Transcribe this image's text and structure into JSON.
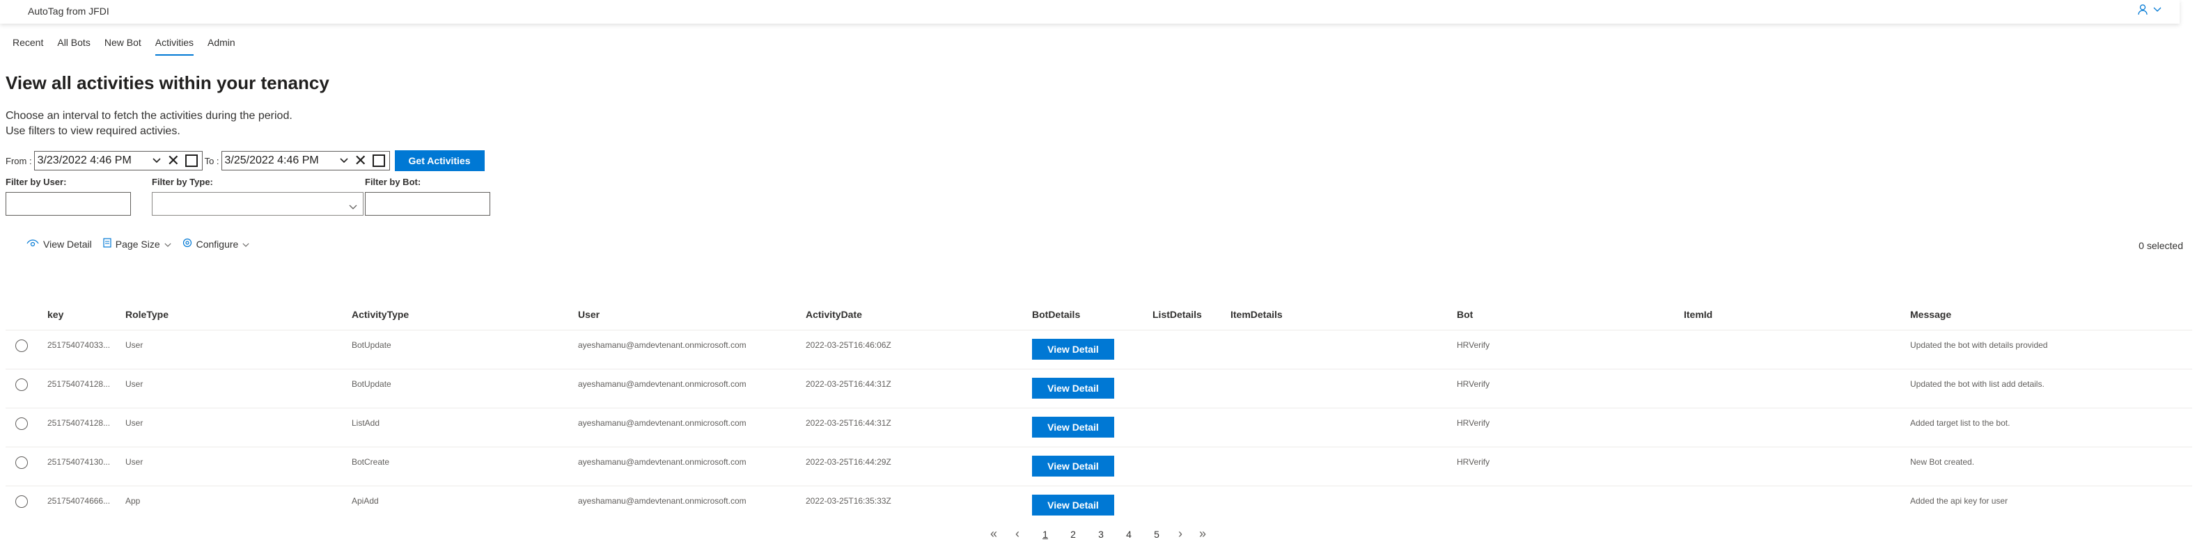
{
  "app": {
    "title": "AutoTag from JFDI"
  },
  "nav": {
    "tabs": [
      "Recent",
      "All Bots",
      "New Bot",
      "Activities",
      "Admin"
    ],
    "active": "Activities"
  },
  "page": {
    "title": "View all activities within your tenancy",
    "desc1": "Choose an interval to fetch the activities during the period.",
    "desc2": "Use filters to view required activies."
  },
  "date": {
    "from_label": "From :",
    "to_label": "To :",
    "from_value": "3/23/2022 4:46 PM",
    "to_value": "3/25/2022 4:46 PM",
    "clear_glyph": "✕",
    "button": "Get Activities"
  },
  "filters": {
    "user_label": "Filter by User:",
    "type_label": "Filter by Type:",
    "bot_label": "Filter by Bot:"
  },
  "commands": {
    "view_detail": "View Detail",
    "page_size": "Page Size",
    "configure": "Configure",
    "selected": "0 selected"
  },
  "columns": [
    "key",
    "RoleType",
    "ActivityType",
    "User",
    "ActivityDate",
    "BotDetails",
    "ListDetails",
    "ItemDetails",
    "Bot",
    "ItemId",
    "Message"
  ],
  "rows": [
    {
      "key": "251754074033...",
      "role": "User",
      "type": "BotUpdate",
      "user": "ayeshamanu@amdevtenant.onmicrosoft.com",
      "date": "2022-03-25T16:46:06Z",
      "bot": "HRVerify",
      "message": "Updated the bot with details provided"
    },
    {
      "key": "251754074128...",
      "role": "User",
      "type": "BotUpdate",
      "user": "ayeshamanu@amdevtenant.onmicrosoft.com",
      "date": "2022-03-25T16:44:31Z",
      "bot": "HRVerify",
      "message": "Updated the bot with list add details."
    },
    {
      "key": "251754074128...",
      "role": "User",
      "type": "ListAdd",
      "user": "ayeshamanu@amdevtenant.onmicrosoft.com",
      "date": "2022-03-25T16:44:31Z",
      "bot": "HRVerify",
      "message": "Added target list to the bot."
    },
    {
      "key": "251754074130...",
      "role": "User",
      "type": "BotCreate",
      "user": "ayeshamanu@amdevtenant.onmicrosoft.com",
      "date": "2022-03-25T16:44:29Z",
      "bot": "HRVerify",
      "message": "New Bot created."
    },
    {
      "key": "251754074666...",
      "role": "App",
      "type": "ApiAdd",
      "user": "ayeshamanu@amdevtenant.onmicrosoft.com",
      "date": "2022-03-25T16:35:33Z",
      "bot": "",
      "message": "Added the api key for user"
    }
  ],
  "row_button": "View Detail",
  "pagination": {
    "first": "«",
    "prev": "‹",
    "pages": [
      "1",
      "2",
      "3",
      "4",
      "5"
    ],
    "current": "1",
    "next": "›",
    "last": "»"
  },
  "colors": {
    "accent": "#0078d4",
    "text": "#323130",
    "muted": "#605e5c",
    "divider": "#edebe9"
  }
}
